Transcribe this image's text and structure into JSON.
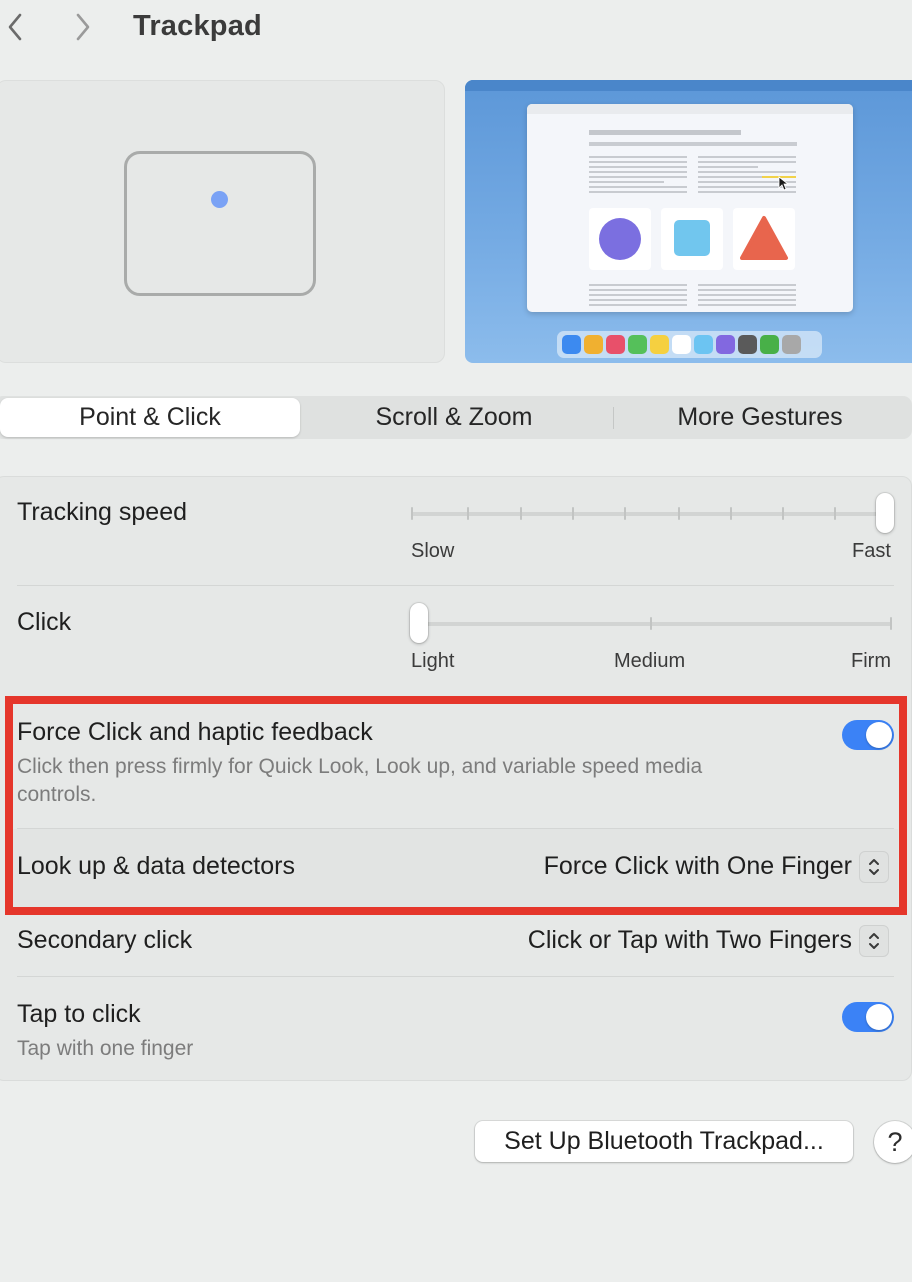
{
  "header": {
    "title": "Trackpad",
    "back_icon": "chevron-left-icon",
    "forward_icon": "chevron-right-icon"
  },
  "tabs": [
    {
      "label": "Point & Click",
      "active": true
    },
    {
      "label": "Scroll & Zoom",
      "active": false
    },
    {
      "label": "More Gestures",
      "active": false
    }
  ],
  "settings": {
    "tracking_speed": {
      "label": "Tracking speed",
      "min_label": "Slow",
      "max_label": "Fast",
      "value": 1.0,
      "ticks": 10
    },
    "click": {
      "label": "Click",
      "labels": [
        "Light",
        "Medium",
        "Firm"
      ],
      "value": 0.0
    },
    "force_click": {
      "label": "Force Click and haptic feedback",
      "description": "Click then press firmly for Quick Look, Look up, and variable speed media controls.",
      "enabled": true
    },
    "look_up": {
      "label": "Look up & data detectors",
      "value": "Force Click with One Finger"
    },
    "secondary_click": {
      "label": "Secondary click",
      "value": "Click or Tap with Two Fingers"
    },
    "tap_to_click": {
      "label": "Tap to click",
      "description": "Tap with one finger",
      "enabled": true
    }
  },
  "buttons": {
    "bluetooth": "Set Up Bluetooth Trackpad...",
    "help": "?"
  },
  "colors": {
    "accent": "#3b82f6",
    "highlight_border": "#e5362b",
    "window_bg": "#eceeed"
  }
}
